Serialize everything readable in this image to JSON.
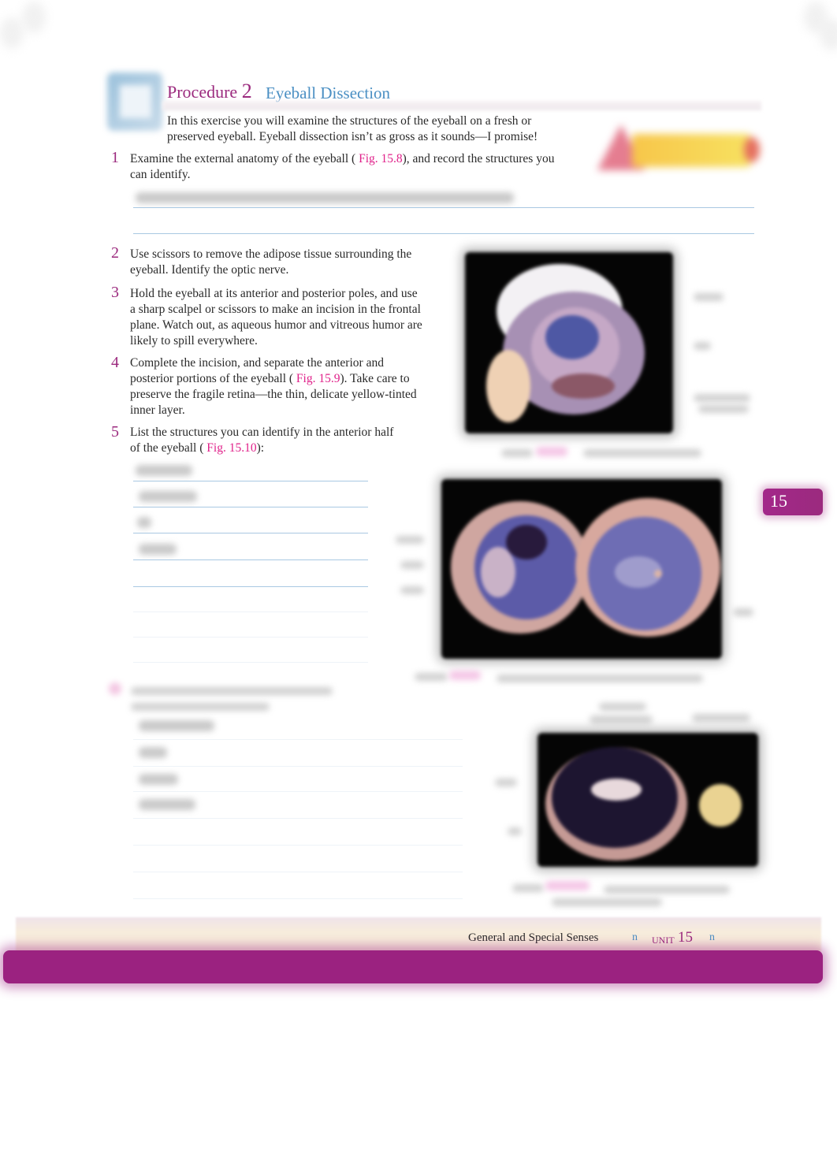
{
  "procedure": {
    "label": "Procedure",
    "number": "2",
    "title": "Eyeball Dissection",
    "intro": "In this exercise you will examine the structures of the eyeball on a fresh or preserved eyeball. Eyeball dissection isn’t as gross as it sounds—I promise!",
    "safety_icon": "safety-warning-icon",
    "procedure_icon": "procedure-icon"
  },
  "steps": [
    {
      "number": "1",
      "text_before": "Examine the external anatomy of the eyeball (",
      "fig_ref": "Fig. 15.8",
      "text_after": "), and record the structures you can identify."
    },
    {
      "number": "2",
      "text": "Use scissors to remove the adipose tissue surrounding the eyeball. Identify the optic nerve."
    },
    {
      "number": "3",
      "text": "Hold the eyeball at its anterior and posterior poles, and use a sharp scalpel or scissors to make an incision in the frontal plane. Watch out, as aqueous humor and vitreous humor are likely to spill everywhere."
    },
    {
      "number": "4",
      "text_before": "Complete the incision, and separate the anterior and posterior portions of the eyeball (",
      "fig_ref": "Fig. 15.9",
      "text_after": "). Take care to preserve the fragile retina—the thin, delicate yellow-tinted inner layer."
    },
    {
      "number": "5",
      "text_before": "List the structures you can identify in the anterior half of the eyeball (",
      "fig_ref": "Fig. 15.10",
      "text_after": "):"
    }
  ],
  "chapter_tab": "15",
  "footer": {
    "section": "General and Special Senses",
    "bullet": "n",
    "unit_label": "UNIT",
    "unit_number": "15"
  },
  "colors": {
    "accent_magenta": "#9b2a7e",
    "accent_blue": "#4a8fc3",
    "fig_ref_pink": "#e0218a",
    "answer_line": "#a9c8e2"
  }
}
